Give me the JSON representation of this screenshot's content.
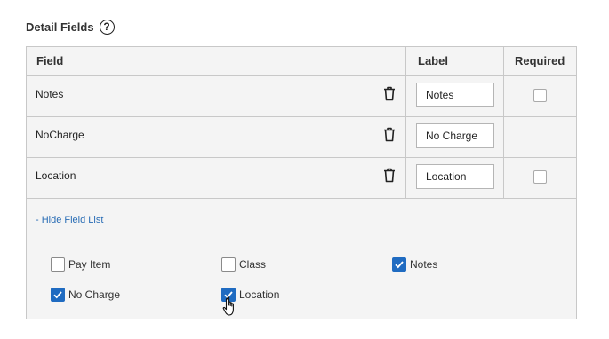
{
  "section": {
    "title": "Detail Fields",
    "help_glyph": "?"
  },
  "table": {
    "headers": {
      "field": "Field",
      "label": "Label",
      "required": "Required"
    },
    "rows": [
      {
        "field": "Notes",
        "label_value": "Notes",
        "has_required": true,
        "required_checked": false
      },
      {
        "field": "NoCharge",
        "label_value": "No Charge",
        "has_required": false,
        "required_checked": false
      },
      {
        "field": "Location",
        "label_value": "Location",
        "has_required": true,
        "required_checked": false
      }
    ]
  },
  "field_list": {
    "toggle_label": "- Hide Field List",
    "options": [
      {
        "label": "Pay Item",
        "checked": false
      },
      {
        "label": "Class",
        "checked": false
      },
      {
        "label": "Notes",
        "checked": true
      },
      {
        "label": "No Charge",
        "checked": true
      },
      {
        "label": "Location",
        "checked": true
      }
    ]
  },
  "colors": {
    "accent": "#1f6bc1",
    "link": "#2a6db5",
    "border": "#c8c8c8",
    "row_bg": "#f4f4f4"
  },
  "icons": {
    "help": "help-circle-icon",
    "delete": "trash-icon",
    "check": "checkmark-icon",
    "cursor": "hand-pointer-cursor"
  }
}
